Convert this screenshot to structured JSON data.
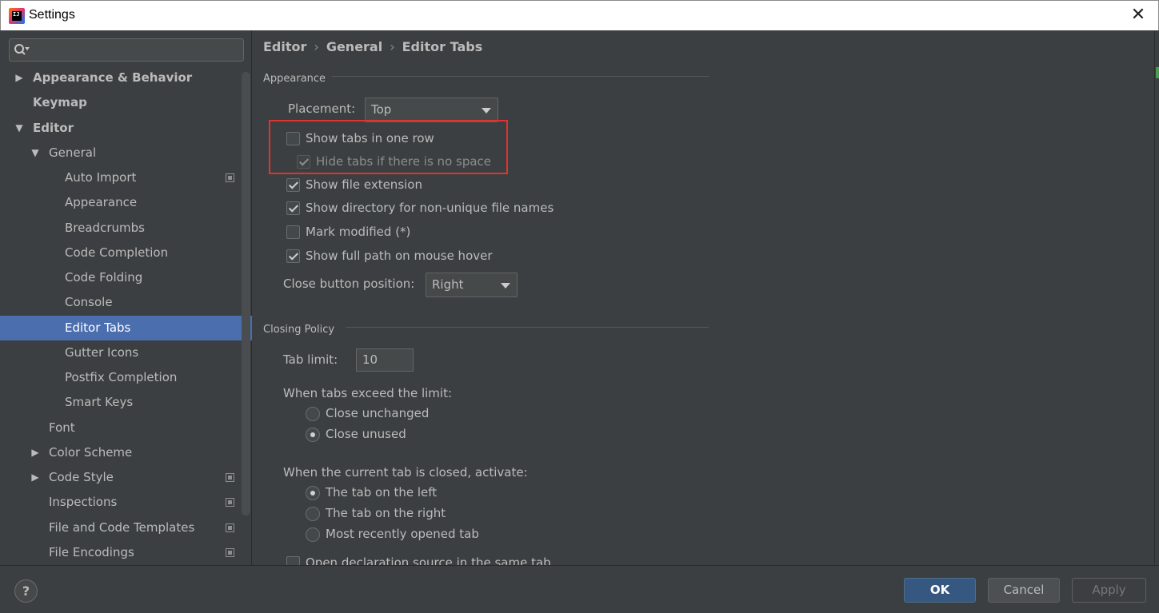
{
  "window": {
    "title": "Settings",
    "app_icon_text": "IJ"
  },
  "sidebar": {
    "search_placeholder": "",
    "items": [
      {
        "label": "Appearance & Behavior",
        "arrow": "▶"
      },
      {
        "label": "Keymap",
        "arrow": ""
      },
      {
        "label": "Editor",
        "arrow": "▼"
      },
      {
        "label": "General",
        "arrow": "▼"
      },
      {
        "label": "Auto Import",
        "arrow": ""
      },
      {
        "label": "Appearance",
        "arrow": ""
      },
      {
        "label": "Breadcrumbs",
        "arrow": ""
      },
      {
        "label": "Code Completion",
        "arrow": ""
      },
      {
        "label": "Code Folding",
        "arrow": ""
      },
      {
        "label": "Console",
        "arrow": ""
      },
      {
        "label": "Editor Tabs",
        "arrow": ""
      },
      {
        "label": "Gutter Icons",
        "arrow": ""
      },
      {
        "label": "Postfix Completion",
        "arrow": ""
      },
      {
        "label": "Smart Keys",
        "arrow": ""
      },
      {
        "label": "Font",
        "arrow": ""
      },
      {
        "label": "Color Scheme",
        "arrow": "▶"
      },
      {
        "label": "Code Style",
        "arrow": "▶"
      },
      {
        "label": "Inspections",
        "arrow": ""
      },
      {
        "label": "File and Code Templates",
        "arrow": ""
      },
      {
        "label": "File Encodings",
        "arrow": ""
      }
    ],
    "selected": "Editor Tabs"
  },
  "breadcrumb": {
    "parts": [
      "Editor",
      "General",
      "Editor Tabs"
    ],
    "separator": "›"
  },
  "appearance": {
    "section_title": "Appearance",
    "placement_label": "Placement:",
    "placement_value": "Top",
    "show_tabs_one_row": {
      "label": "Show tabs in one row",
      "checked": false
    },
    "hide_tabs_no_space": {
      "label": "Hide tabs if there is no space",
      "checked": true,
      "enabled": false
    },
    "show_file_extension": {
      "label": "Show file extension",
      "checked": true
    },
    "show_directory": {
      "label": "Show directory for non-unique file names",
      "checked": true
    },
    "mark_modified": {
      "label": "Mark modified (*)",
      "checked": false
    },
    "show_full_path": {
      "label": "Show full path on mouse hover",
      "checked": true
    },
    "close_button_label": "Close button position:",
    "close_button_value": "Right"
  },
  "closing_policy": {
    "section_title": "Closing Policy",
    "tab_limit_label": "Tab limit:",
    "tab_limit_value": "10",
    "exceed_label": "When tabs exceed the limit:",
    "exceed_options": [
      {
        "label": "Close unchanged",
        "selected": false
      },
      {
        "label": "Close unused",
        "selected": true
      }
    ],
    "closed_label": "When the current tab is closed, activate:",
    "closed_options": [
      {
        "label": "The tab on the left",
        "selected": true
      },
      {
        "label": "The tab on the right",
        "selected": false
      },
      {
        "label": "Most recently opened tab",
        "selected": false
      }
    ],
    "open_declaration": {
      "label": "Open declaration source in the same tab",
      "checked": false
    }
  },
  "footer": {
    "help_label": "?",
    "ok_label": "OK",
    "cancel_label": "Cancel",
    "apply_label": "Apply"
  },
  "colors": {
    "selection": "#4b6eaf",
    "highlight_box": "#e0332f",
    "ok_button": "#365880"
  }
}
